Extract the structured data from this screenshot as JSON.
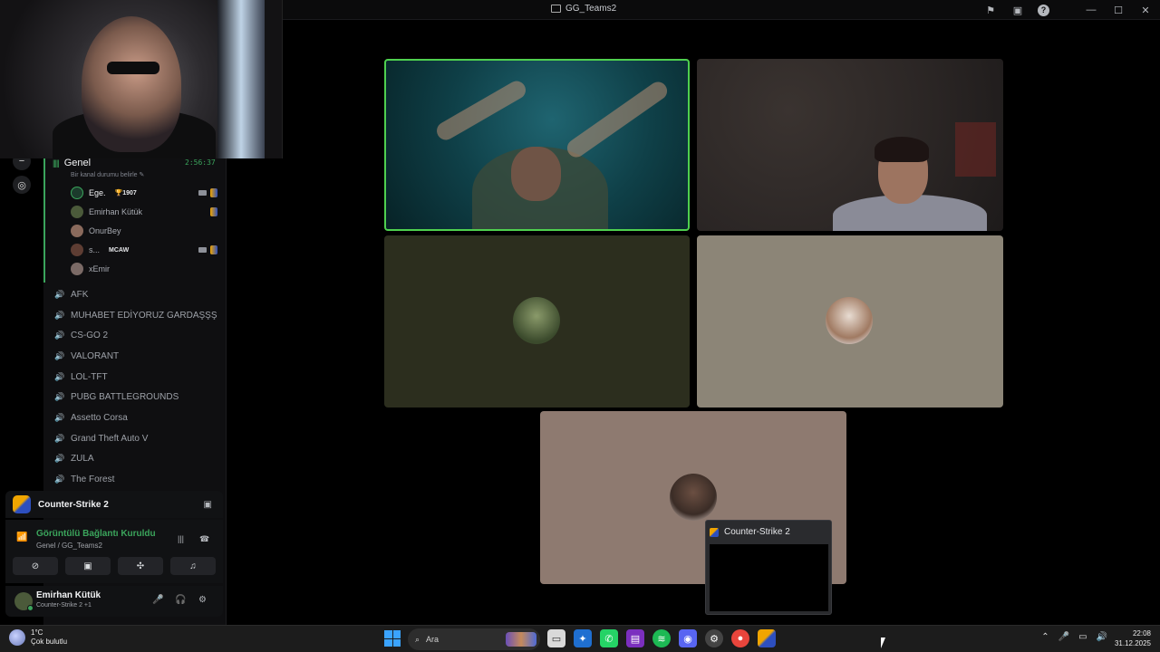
{
  "window": {
    "title": "GG_Teams2"
  },
  "channel": {
    "name": "Genel",
    "timer": "2:56:37",
    "status_placeholder": "Bir kanal durumu belirle",
    "members": [
      {
        "name": "Ege.",
        "badge": "🏆1907",
        "camera": true,
        "game": true
      },
      {
        "name": "Emirhan Kütük",
        "badge": "",
        "camera": false,
        "game": true
      },
      {
        "name": "OnurBey",
        "badge": "",
        "camera": false,
        "game": false
      },
      {
        "name": "s...",
        "badge": "MCAW",
        "camera": true,
        "game": true
      },
      {
        "name": "xEmir",
        "badge": "",
        "camera": false,
        "game": false
      }
    ]
  },
  "voice_channels": [
    "AFK",
    "MUHABET EDİYORUZ GARDAŞŞŞ",
    "CS-GO 2",
    "VALORANT",
    "LOL-TFT",
    "PUBG BATTLEGROUNDS",
    "Assetto Corsa",
    "Grand Theft Auto V",
    "ZULA",
    "The Forest"
  ],
  "activity": {
    "game": "Counter-Strike 2"
  },
  "voice_connection": {
    "status": "Görüntülü Bağlantı Kuruldu",
    "location": "Genel / GG_Teams2"
  },
  "user": {
    "name": "Emirhan Kütük",
    "activity": "Counter-Strike 2 +1"
  },
  "preview": {
    "title": "Counter-Strike 2"
  },
  "taskbar": {
    "weather_temp": "1°C",
    "weather_desc": "Çok bulutlu",
    "search_placeholder": "Ara",
    "time": "22:08",
    "date": "31.12.2025"
  },
  "colors": {
    "speaking": "#4fd04f",
    "connected": "#3ba55c"
  }
}
